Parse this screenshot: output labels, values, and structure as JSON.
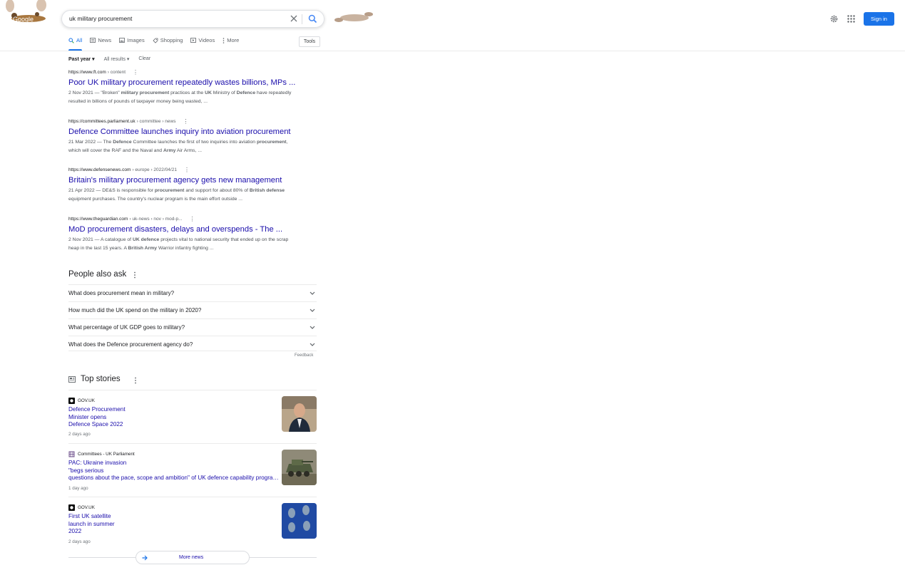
{
  "search": {
    "query": "uk military procurement"
  },
  "header": {
    "sign_in_label": "Sign in",
    "logo_text": "Google"
  },
  "tabs": [
    {
      "label": "All",
      "icon": "search-icon",
      "active": true
    },
    {
      "label": "News",
      "icon": "news-icon"
    },
    {
      "label": "Images",
      "icon": "image-icon"
    },
    {
      "label": "Shopping",
      "icon": "tag-icon"
    },
    {
      "label": "Videos",
      "icon": "play-icon"
    },
    {
      "label": "More",
      "icon": "kebab-icon"
    }
  ],
  "tools_label": "Tools",
  "filters": {
    "time": "Past year",
    "results": "All results",
    "clear": "Clear"
  },
  "results": [
    {
      "domain": "https://www.ft.com",
      "path": "› content",
      "title": "Poor UK military procurement repeatedly wastes billions, MPs ...",
      "snippet_html": "2 Nov 2021 — \"Broken\" <b>military procurement</b> practices at the <b>UK</b> Ministry of <b>Defence</b> have repeatedly resulted in billions of pounds of taxpayer money being wasted, ..."
    },
    {
      "domain": "https://committees.parliament.uk",
      "path": "› committee › news",
      "title": "Defence Committee launches inquiry into aviation procurement",
      "snippet_html": "21 Mar 2022 — The <b>Defence</b> Committee launches the first of two inquiries into aviation <b>procurement</b>, which will cover the RAF and the Naval and <b>Army</b> Air Arms, ..."
    },
    {
      "domain": "https://www.defensenews.com",
      "path": "› europe › 2022/04/21",
      "title": "Britain's military procurement agency gets new management",
      "snippet_html": "21 Apr 2022 — DE&amp;S is responsible for <b>procurement</b> and support for about 80% of <b>British defense</b> equipment purchases. The country's nuclear program is the main effort outside ..."
    },
    {
      "domain": "https://www.theguardian.com",
      "path": "› uk-news › nov › mod-p...",
      "title": "MoD procurement disasters, delays and overspends - The ...",
      "snippet_html": "2 Nov 2021 — A catalogue of <b>UK defence</b> projects vital to national security that ended up on the scrap heap in the last 15 years. A <b>British Army</b> Warrior infantry fighting ..."
    }
  ],
  "people_also_ask": {
    "title": "People also ask",
    "questions": [
      "What does procurement mean in military?",
      "How much did the UK spend on the military in 2020?",
      "What percentage of UK GDP goes to military?",
      "What does the Defence procurement agency do?"
    ],
    "feedback": "Feedback"
  },
  "top_stories": {
    "title": "Top stories",
    "items": [
      {
        "source": "GOV.UK",
        "lines": [
          "Defence Procurement",
          "Minister opens",
          "Defence Space 2022"
        ],
        "age": "2 days ago"
      },
      {
        "source": "Committees - UK Parliament",
        "lines": [
          "PAC: Ukraine invasion",
          "\"begs serious",
          "questions about the pace, scope and ambition\" of UK defence capability programme"
        ],
        "age": "1 day ago"
      },
      {
        "source": "GOV.UK",
        "lines": [
          "First UK satellite",
          "launch in summer",
          "2022"
        ],
        "age": "2 days ago"
      }
    ],
    "more_label": "More news"
  }
}
